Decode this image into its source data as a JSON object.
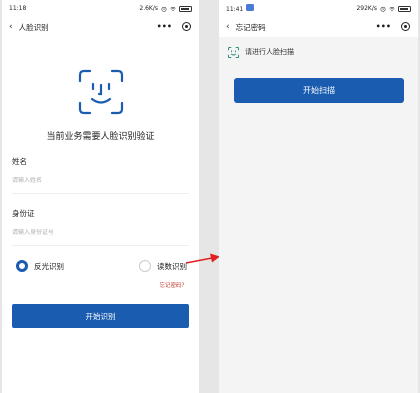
{
  "left": {
    "status": {
      "time": "11:18",
      "speed": "2.6K/s",
      "battery": "88"
    },
    "nav": {
      "title": "人脸识别"
    },
    "face_prompt": "当前业务需要人脸识别验证",
    "fields": [
      {
        "label": "姓名",
        "placeholder": "请输入姓名"
      },
      {
        "label": "身份证",
        "placeholder": "请输入身份证号"
      }
    ],
    "radios": [
      {
        "label": "反光识别",
        "selected": true
      },
      {
        "label": "读数识别",
        "selected": false
      }
    ],
    "forgot_link": "忘记密码？",
    "submit_label": "开始识别"
  },
  "right": {
    "status": {
      "time": "11:41",
      "speed": "292K/s",
      "battery": "88"
    },
    "nav": {
      "title": "忘记密码"
    },
    "scan_hint": "请进行人脸扫描",
    "scan_button": "开始扫描"
  },
  "colors": {
    "primary": "#1a5cb0",
    "link": "#c0392b",
    "arrow": "#e02020"
  }
}
